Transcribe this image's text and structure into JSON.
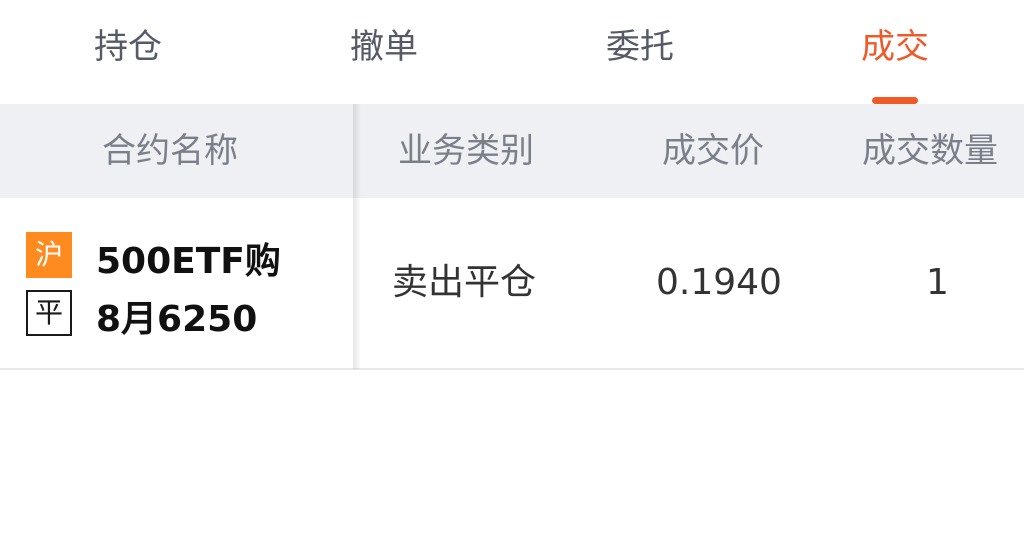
{
  "tabs": [
    {
      "label": "持仓"
    },
    {
      "label": "撤单"
    },
    {
      "label": "委托"
    },
    {
      "label": "成交"
    }
  ],
  "active_tab": "成交",
  "accent_color": "#f05a28",
  "table": {
    "headers": {
      "contract_name": "合约名称",
      "business_type": "业务类别",
      "price": "成交价",
      "quantity": "成交数量"
    },
    "rows": [
      {
        "exchange_badge": "沪",
        "action_badge": "平",
        "contract_line1": "500ETF购",
        "contract_line2": "8月6250",
        "business_type": "卖出平仓",
        "price": "0.1940",
        "quantity": "1"
      }
    ]
  }
}
